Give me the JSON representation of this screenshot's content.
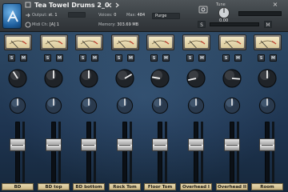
{
  "header": {
    "instrument_name": "Tea Towel Drums 2_0",
    "output_label": "Output:",
    "output_value": "st. 1",
    "midi_label": "Midi Ch:",
    "midi_value": "[A] 1",
    "voices_label": "Voices:",
    "voices_value": "0",
    "max_label": "Max:",
    "max_value": "484",
    "memory_label": "Memory:",
    "memory_value": "303.69 MB",
    "purge_label": "Purge",
    "tune_label": "Tune",
    "tune_value": "0.00",
    "solo_label": "S",
    "mute_label": "M",
    "close_symbol": "×"
  },
  "icons": {
    "logo": "kontakt-logo-icon",
    "output": "output-icon",
    "midi": "midi-icon",
    "nav_prev": "chevron-left-icon",
    "nav_next": "chevron-right-icon",
    "snapshot": "camera-icon",
    "close": "close-icon"
  },
  "mixer": {
    "solo_label": "S",
    "mute_label": "M",
    "channels": [
      {
        "name": "BD",
        "pan": 0.38,
        "reverb": 0.5,
        "fader": 0.65
      },
      {
        "name": "BD top",
        "pan": 0.5,
        "reverb": 0.5,
        "fader": 0.65
      },
      {
        "name": "BD bottom",
        "pan": 0.5,
        "reverb": 0.5,
        "fader": 0.65
      },
      {
        "name": "Rock Tom",
        "pan": 0.72,
        "reverb": 0.5,
        "fader": 0.65
      },
      {
        "name": "Floor Tom",
        "pan": 0.2,
        "reverb": 0.5,
        "fader": 0.65
      },
      {
        "name": "Overhead I",
        "pan": 0.12,
        "reverb": 0.5,
        "fader": 0.65
      },
      {
        "name": "Overhead II",
        "pan": 0.85,
        "reverb": 0.5,
        "fader": 0.65
      },
      {
        "name": "Room",
        "pan": 0.5,
        "reverb": 0.5,
        "fader": 0.65
      }
    ]
  }
}
